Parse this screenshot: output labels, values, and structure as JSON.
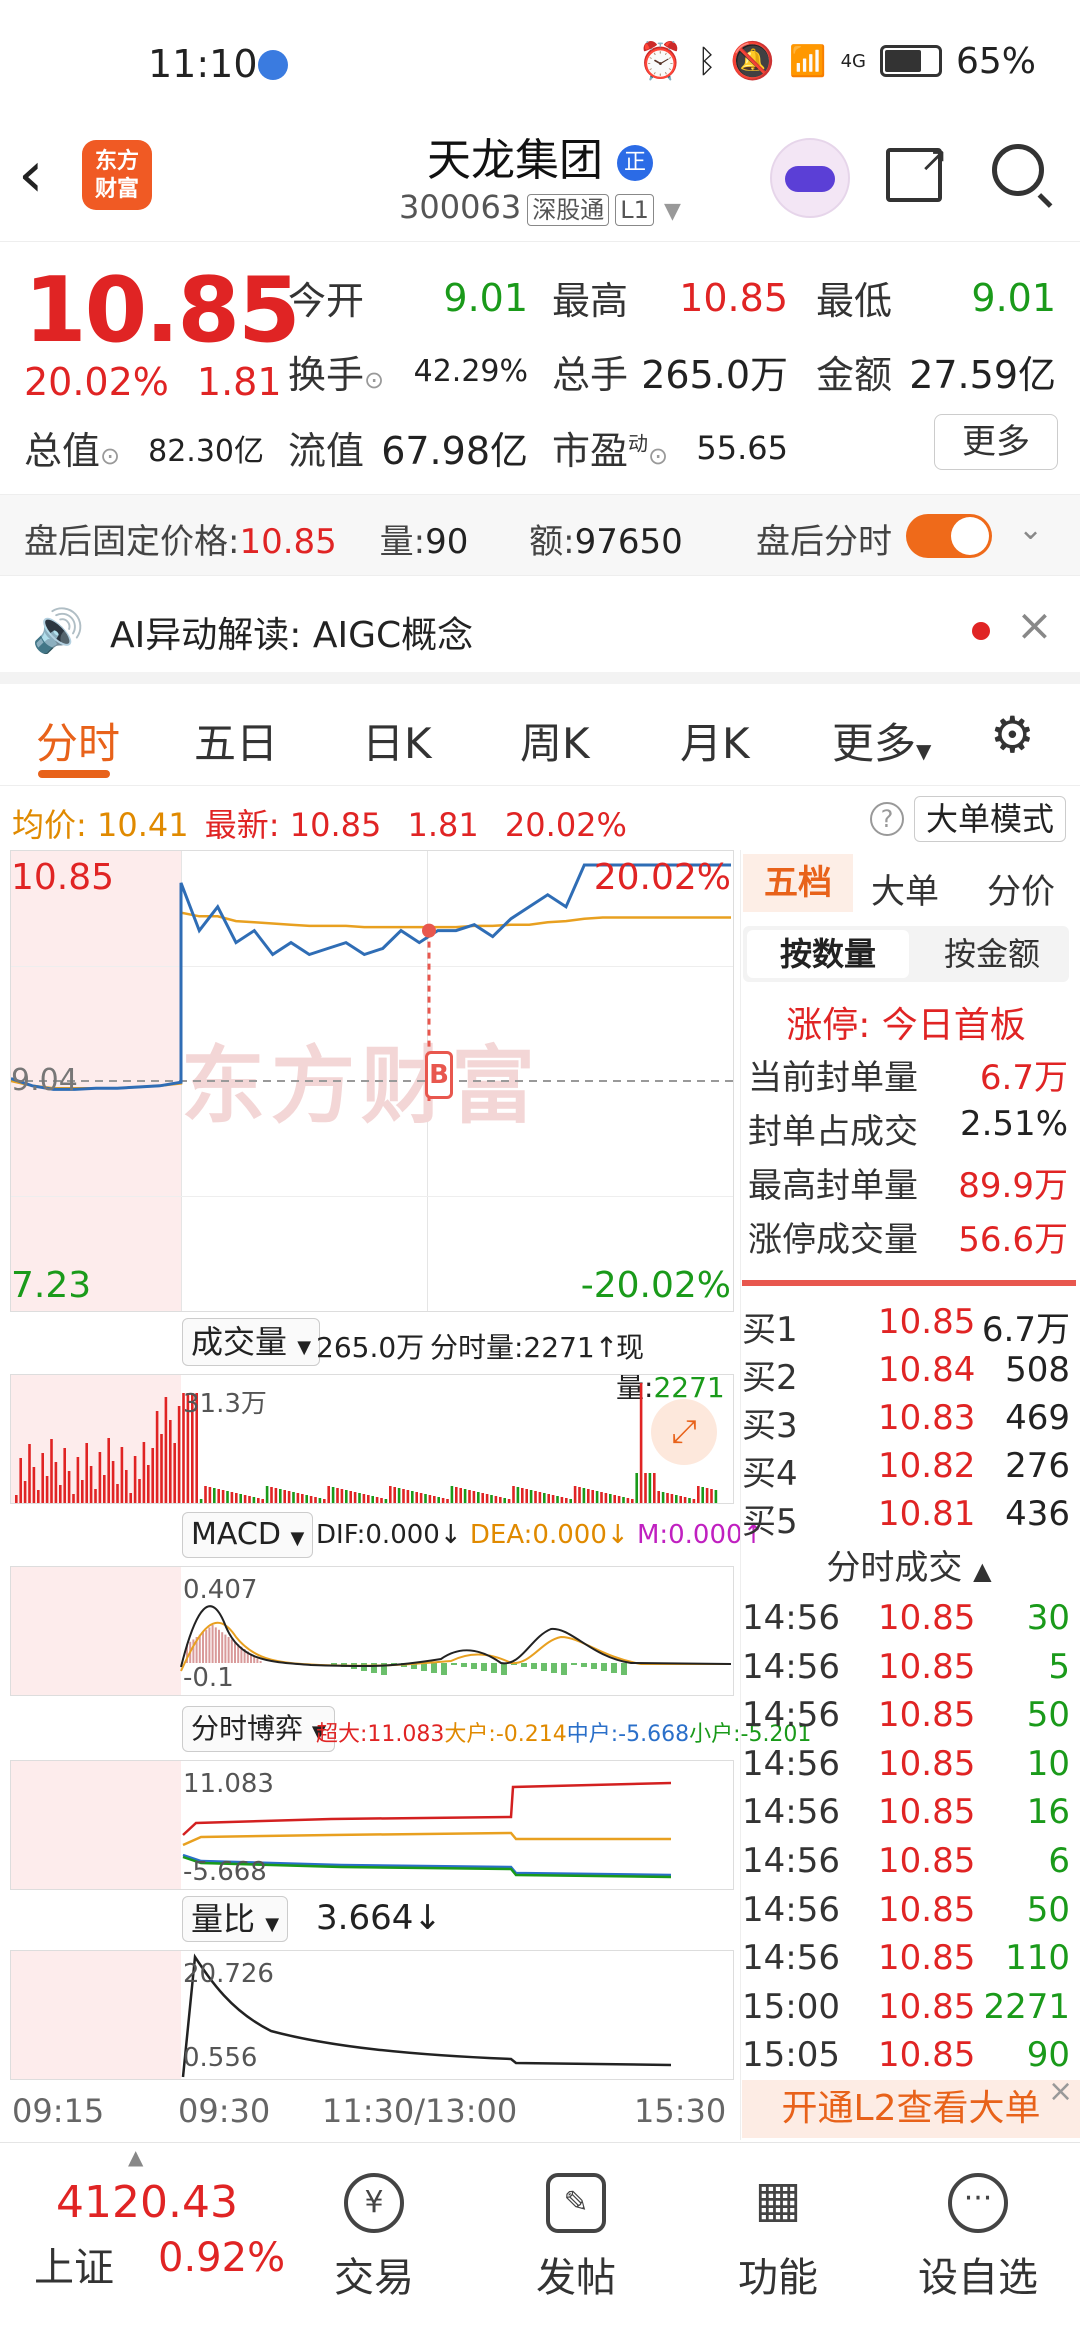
{
  "status": {
    "time": "11:10",
    "network": "4G",
    "battery": "65%"
  },
  "header": {
    "logo_line1": "东方",
    "logo_line2": "财富",
    "name": "天龙集团",
    "badge": "正",
    "code": "300063",
    "tag1": "深股通",
    "tag2": "L1"
  },
  "quote": {
    "price": "10.85",
    "change_pct": "20.02%",
    "change": "1.81",
    "open_label": "今开",
    "open": "9.01",
    "high_label": "最高",
    "high": "10.85",
    "low_label": "最低",
    "low": "9.01",
    "turnover_label": "换手",
    "turnover": "42.29%",
    "volume_label": "总手",
    "volume": "265.0万",
    "amount_label": "金额",
    "amount": "27.59亿",
    "mktcap_label": "总值",
    "mktcap": "82.30亿",
    "float_label": "流值",
    "float": "67.98亿",
    "pe_label": "市盈",
    "pe_sup": "动",
    "pe": "55.65",
    "more": "更多"
  },
  "afterhours": {
    "price_label": "盘后固定价格:",
    "price": "10.85",
    "vol_label": "量:",
    "vol": "90",
    "amt_label": "额:",
    "amt": "97650",
    "toggle_label": "盘后分时"
  },
  "ai": {
    "label": "AI异动解读:",
    "topic": "AIGC概念"
  },
  "tabs": [
    "分时",
    "五日",
    "日K",
    "周K",
    "月K",
    "更多"
  ],
  "info": {
    "avg_label": "均价:",
    "avg": "10.41",
    "latest_label": "最新:",
    "latest": "10.85",
    "chg": "1.81",
    "pct": "20.02%",
    "mode": "大单模式"
  },
  "chart_data": {
    "type": "line",
    "title": "",
    "x_ticks": [
      "09:15",
      "09:30",
      "11:30/13:00",
      "15:30"
    ],
    "ylim": [
      7.23,
      10.85
    ],
    "y_labels": {
      "top": "10.85",
      "bottom": "7.23",
      "pre_close": "9.04",
      "top_pct": "20.02%",
      "bottom_pct": "-20.02%"
    },
    "series": [],
    "price_values": [
      9.06,
      9.0,
      8.97,
      8.97,
      8.98,
      8.98,
      8.99,
      9.0,
      9.03,
      10.7,
      10.3,
      10.5,
      10.2,
      10.3,
      10.1,
      10.2,
      10.1,
      10.15,
      10.2,
      10.1,
      10.15,
      10.3,
      10.2,
      10.3,
      10.3,
      10.35,
      10.25,
      10.4,
      10.5,
      10.6,
      10.5,
      10.85,
      10.85,
      10.85,
      10.85,
      10.85,
      10.85,
      10.85,
      10.85,
      10.85
    ],
    "avg_values": [
      9.04,
      9.0,
      8.98,
      8.98,
      8.98,
      8.98,
      8.99,
      9.0,
      9.02,
      10.45,
      10.42,
      10.42,
      10.38,
      10.37,
      10.36,
      10.35,
      10.34,
      10.34,
      10.34,
      10.33,
      10.33,
      10.33,
      10.33,
      10.33,
      10.33,
      10.34,
      10.34,
      10.35,
      10.35,
      10.37,
      10.38,
      10.4,
      10.41,
      10.41,
      10.41,
      10.41,
      10.41,
      10.41,
      10.41,
      10.41
    ]
  },
  "volume_panel": {
    "label": "成交量",
    "total": "265.0万",
    "tick_label": "分时量:2271",
    "now_label": "现量:",
    "now": "2271",
    "max": "31.3万"
  },
  "macd_panel": {
    "label": "MACD",
    "dif": "DIF:0.000",
    "dea": "DEA:0.000",
    "m": "M:0.000",
    "max": "0.407",
    "min": "-0.1"
  },
  "flow_panel": {
    "label": "分时博弈",
    "super": "超大:11.083",
    "large": "大户:-0.214",
    "mid": "中户:-5.668",
    "small": "小户:-5.201",
    "max": "11.083",
    "min": "-5.668"
  },
  "ratio_panel": {
    "label": "量比",
    "value": "3.664",
    "max": "20.726",
    "min": "0.556"
  },
  "side": {
    "tab1": "五档",
    "tab2": "大单",
    "tab3": "分价",
    "sub1": "按数量",
    "sub2": "按金额",
    "limit_title": "涨停: 今日首板",
    "stats": [
      {
        "label": "当前封单量",
        "value": "6.7万"
      },
      {
        "label": "封单占成交",
        "value": "2.51%"
      },
      {
        "label": "最高封单量",
        "value": "89.9万"
      },
      {
        "label": "涨停成交量",
        "value": "56.6万"
      }
    ],
    "bids": [
      {
        "label": "买1",
        "price": "10.85",
        "vol": "6.7万"
      },
      {
        "label": "买2",
        "price": "10.84",
        "vol": "508"
      },
      {
        "label": "买3",
        "price": "10.83",
        "vol": "469"
      },
      {
        "label": "买4",
        "price": "10.82",
        "vol": "276"
      },
      {
        "label": "买5",
        "price": "10.81",
        "vol": "436"
      }
    ],
    "trades_title": "分时成交",
    "trades": [
      {
        "time": "14:56",
        "price": "10.85",
        "vol": "30"
      },
      {
        "time": "14:56",
        "price": "10.85",
        "vol": "5"
      },
      {
        "time": "14:56",
        "price": "10.85",
        "vol": "50"
      },
      {
        "time": "14:56",
        "price": "10.85",
        "vol": "10"
      },
      {
        "time": "14:56",
        "price": "10.85",
        "vol": "16"
      },
      {
        "time": "14:56",
        "price": "10.85",
        "vol": "6"
      },
      {
        "time": "14:56",
        "price": "10.85",
        "vol": "50"
      },
      {
        "time": "14:56",
        "price": "10.85",
        "vol": "110"
      },
      {
        "time": "15:00",
        "price": "10.85",
        "vol": "2271"
      },
      {
        "time": "15:05",
        "price": "10.85",
        "vol": "90"
      }
    ],
    "l2_banner": "开通L2查看大单"
  },
  "bottom": {
    "index_value": "4120.43",
    "index_name": "上证",
    "index_pct": "0.92%",
    "nav": [
      {
        "label": "交易",
        "icon": "¥"
      },
      {
        "label": "发帖",
        "icon": "✎"
      },
      {
        "label": "功能",
        "icon": "▦"
      },
      {
        "label": "设自选",
        "icon": "···"
      }
    ]
  }
}
